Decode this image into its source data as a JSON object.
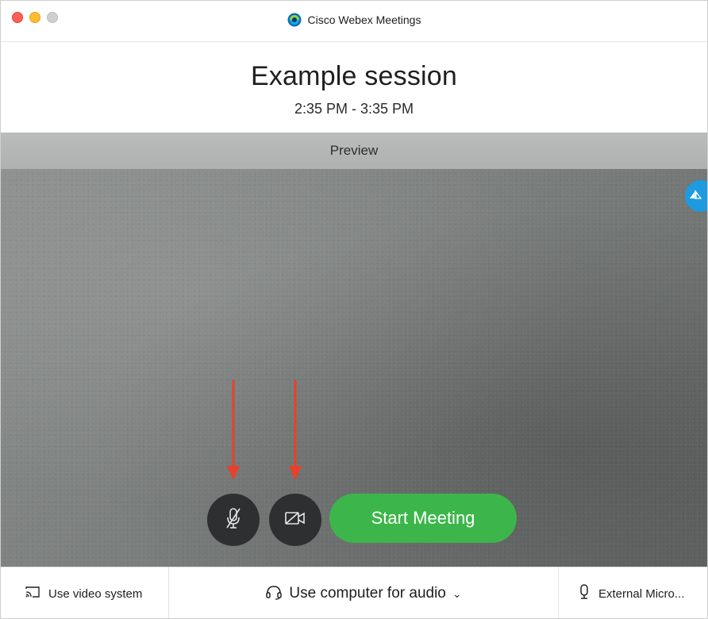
{
  "window": {
    "title": "Cisco Webex Meetings",
    "icons": [
      "close-light",
      "minimize-light",
      "zoom-light",
      "webex-logo-icon"
    ]
  },
  "meeting": {
    "title": "Example session",
    "time": "2:35 PM - 3:35 PM"
  },
  "preview": {
    "label": "Preview",
    "corner_icon": "self-view-icon"
  },
  "controls": {
    "mute_icon": "microphone-muted-icon",
    "video_icon": "video-camera-off-icon",
    "start_label": "Start Meeting",
    "annotation_arrows": [
      "arrow-to-mute",
      "arrow-to-video"
    ]
  },
  "bottom": {
    "video_system_label": "Use video system",
    "audio_label": "Use computer for audio",
    "audio_chevron": "⌄",
    "microphone_label": "External Micro..."
  },
  "colors": {
    "start_button": "#3cb64a",
    "control_button": "#2d2f30",
    "corner_button": "#1e9be0",
    "annotation_arrow": "#e8412b"
  }
}
